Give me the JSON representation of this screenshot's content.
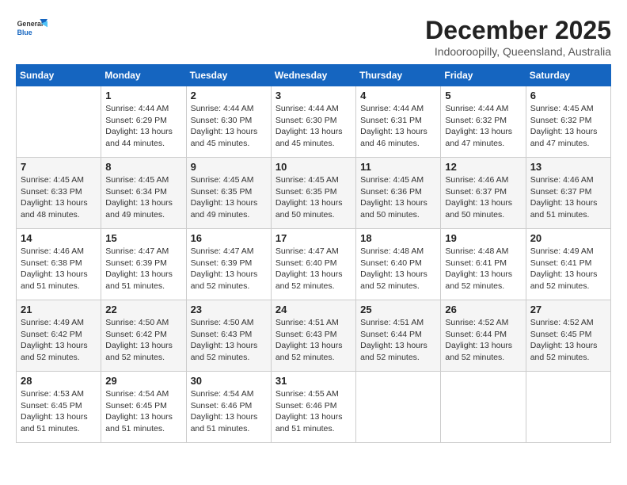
{
  "header": {
    "logo_general": "General",
    "logo_blue": "Blue",
    "title": "December 2025",
    "subtitle": "Indooroopilly, Queensland, Australia"
  },
  "days_of_week": [
    "Sunday",
    "Monday",
    "Tuesday",
    "Wednesday",
    "Thursday",
    "Friday",
    "Saturday"
  ],
  "weeks": [
    [
      {
        "day": "",
        "info": ""
      },
      {
        "day": "1",
        "info": "Sunrise: 4:44 AM\nSunset: 6:29 PM\nDaylight: 13 hours\nand 44 minutes."
      },
      {
        "day": "2",
        "info": "Sunrise: 4:44 AM\nSunset: 6:30 PM\nDaylight: 13 hours\nand 45 minutes."
      },
      {
        "day": "3",
        "info": "Sunrise: 4:44 AM\nSunset: 6:30 PM\nDaylight: 13 hours\nand 45 minutes."
      },
      {
        "day": "4",
        "info": "Sunrise: 4:44 AM\nSunset: 6:31 PM\nDaylight: 13 hours\nand 46 minutes."
      },
      {
        "day": "5",
        "info": "Sunrise: 4:44 AM\nSunset: 6:32 PM\nDaylight: 13 hours\nand 47 minutes."
      },
      {
        "day": "6",
        "info": "Sunrise: 4:45 AM\nSunset: 6:32 PM\nDaylight: 13 hours\nand 47 minutes."
      }
    ],
    [
      {
        "day": "7",
        "info": "Sunrise: 4:45 AM\nSunset: 6:33 PM\nDaylight: 13 hours\nand 48 minutes."
      },
      {
        "day": "8",
        "info": "Sunrise: 4:45 AM\nSunset: 6:34 PM\nDaylight: 13 hours\nand 49 minutes."
      },
      {
        "day": "9",
        "info": "Sunrise: 4:45 AM\nSunset: 6:35 PM\nDaylight: 13 hours\nand 49 minutes."
      },
      {
        "day": "10",
        "info": "Sunrise: 4:45 AM\nSunset: 6:35 PM\nDaylight: 13 hours\nand 50 minutes."
      },
      {
        "day": "11",
        "info": "Sunrise: 4:45 AM\nSunset: 6:36 PM\nDaylight: 13 hours\nand 50 minutes."
      },
      {
        "day": "12",
        "info": "Sunrise: 4:46 AM\nSunset: 6:37 PM\nDaylight: 13 hours\nand 50 minutes."
      },
      {
        "day": "13",
        "info": "Sunrise: 4:46 AM\nSunset: 6:37 PM\nDaylight: 13 hours\nand 51 minutes."
      }
    ],
    [
      {
        "day": "14",
        "info": "Sunrise: 4:46 AM\nSunset: 6:38 PM\nDaylight: 13 hours\nand 51 minutes."
      },
      {
        "day": "15",
        "info": "Sunrise: 4:47 AM\nSunset: 6:39 PM\nDaylight: 13 hours\nand 51 minutes."
      },
      {
        "day": "16",
        "info": "Sunrise: 4:47 AM\nSunset: 6:39 PM\nDaylight: 13 hours\nand 52 minutes."
      },
      {
        "day": "17",
        "info": "Sunrise: 4:47 AM\nSunset: 6:40 PM\nDaylight: 13 hours\nand 52 minutes."
      },
      {
        "day": "18",
        "info": "Sunrise: 4:48 AM\nSunset: 6:40 PM\nDaylight: 13 hours\nand 52 minutes."
      },
      {
        "day": "19",
        "info": "Sunrise: 4:48 AM\nSunset: 6:41 PM\nDaylight: 13 hours\nand 52 minutes."
      },
      {
        "day": "20",
        "info": "Sunrise: 4:49 AM\nSunset: 6:41 PM\nDaylight: 13 hours\nand 52 minutes."
      }
    ],
    [
      {
        "day": "21",
        "info": "Sunrise: 4:49 AM\nSunset: 6:42 PM\nDaylight: 13 hours\nand 52 minutes."
      },
      {
        "day": "22",
        "info": "Sunrise: 4:50 AM\nSunset: 6:42 PM\nDaylight: 13 hours\nand 52 minutes."
      },
      {
        "day": "23",
        "info": "Sunrise: 4:50 AM\nSunset: 6:43 PM\nDaylight: 13 hours\nand 52 minutes."
      },
      {
        "day": "24",
        "info": "Sunrise: 4:51 AM\nSunset: 6:43 PM\nDaylight: 13 hours\nand 52 minutes."
      },
      {
        "day": "25",
        "info": "Sunrise: 4:51 AM\nSunset: 6:44 PM\nDaylight: 13 hours\nand 52 minutes."
      },
      {
        "day": "26",
        "info": "Sunrise: 4:52 AM\nSunset: 6:44 PM\nDaylight: 13 hours\nand 52 minutes."
      },
      {
        "day": "27",
        "info": "Sunrise: 4:52 AM\nSunset: 6:45 PM\nDaylight: 13 hours\nand 52 minutes."
      }
    ],
    [
      {
        "day": "28",
        "info": "Sunrise: 4:53 AM\nSunset: 6:45 PM\nDaylight: 13 hours\nand 51 minutes."
      },
      {
        "day": "29",
        "info": "Sunrise: 4:54 AM\nSunset: 6:45 PM\nDaylight: 13 hours\nand 51 minutes."
      },
      {
        "day": "30",
        "info": "Sunrise: 4:54 AM\nSunset: 6:46 PM\nDaylight: 13 hours\nand 51 minutes."
      },
      {
        "day": "31",
        "info": "Sunrise: 4:55 AM\nSunset: 6:46 PM\nDaylight: 13 hours\nand 51 minutes."
      },
      {
        "day": "",
        "info": ""
      },
      {
        "day": "",
        "info": ""
      },
      {
        "day": "",
        "info": ""
      }
    ]
  ]
}
